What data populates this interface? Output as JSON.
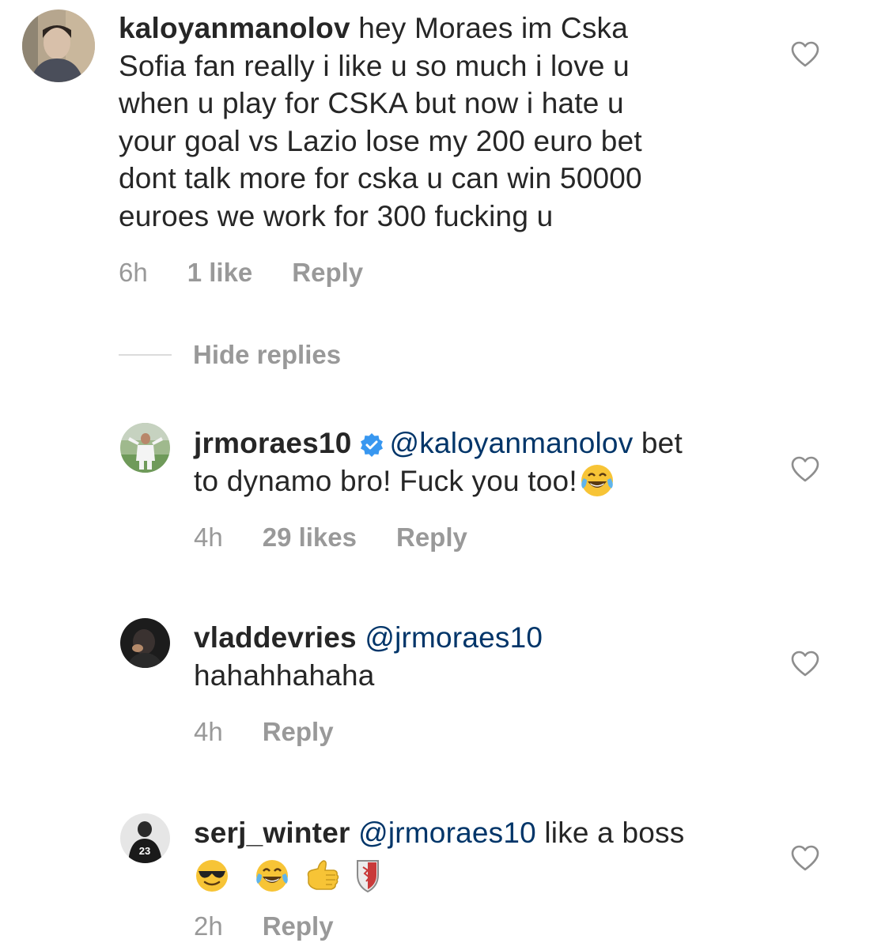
{
  "comments": [
    {
      "username": "kaloyanmanolov",
      "lines": [
        " hey Moraes im Cska",
        "Sofia fan really i like u so much i love u",
        "when u play for CSKA but now i hate u",
        "your goal vs Lazio lose my 200 euro bet",
        "dont talk more for cska u can win 50000",
        "euroes we work for 300 fucking u"
      ],
      "time": "6h",
      "likes": "1 like",
      "reply": "Reply"
    },
    {
      "username": "jrmoraes10",
      "verified": true,
      "mention": "@kaloyanmanolov",
      "text_after_mention": " bet",
      "line2": "to dynamo bro! Fuck you too!",
      "emoji": "face-with-tears-of-joy",
      "time": "4h",
      "likes": "29 likes",
      "reply": "Reply"
    },
    {
      "username": "vladdevries",
      "mention": "@jrmoraes10",
      "line2": "hahahhahaha",
      "time": "4h",
      "reply": "Reply"
    },
    {
      "username": "serj_winter",
      "mention": "@jrmoraes10",
      "text_after_mention": " like a boss",
      "emojis": [
        "smiling-face-with-sunglasses",
        "face-with-tears-of-joy",
        "call-me-hand",
        "shield"
      ],
      "time": "2h",
      "reply": "Reply"
    }
  ],
  "hide_replies": "Hide replies",
  "avatar_badge_number": "23",
  "colors": {
    "text": "#262626",
    "meta": "#999999",
    "mention": "#003569",
    "verified": "#3897f0"
  }
}
